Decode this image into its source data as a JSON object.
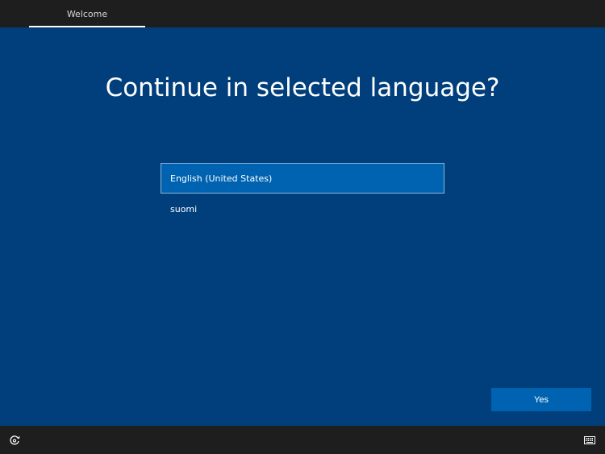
{
  "header": {
    "tab_label": "Welcome"
  },
  "main": {
    "title": "Continue in selected language?",
    "languages": [
      {
        "label": "English (United States)",
        "selected": true
      },
      {
        "label": "suomi",
        "selected": false
      }
    ],
    "yes_label": "Yes"
  },
  "footer": {
    "left_icon": "ease-of-access-icon",
    "right_icon": "keyboard-icon"
  },
  "colors": {
    "background": "#003f7b",
    "bar": "#1e1e1e",
    "accent": "#0063b1"
  }
}
